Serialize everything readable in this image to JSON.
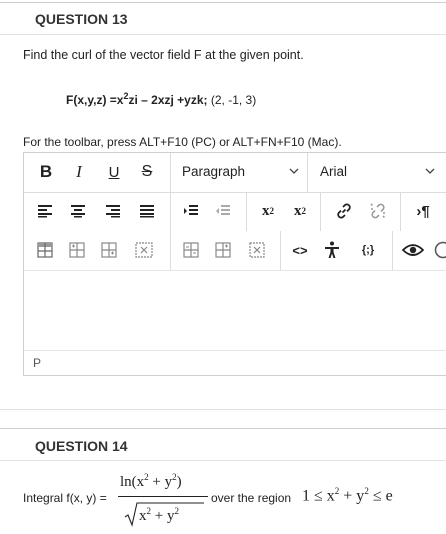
{
  "q13": {
    "title": "QUESTION 13",
    "prompt": "Find the curl of the vector field F at the given point.",
    "formula": {
      "lhs": "F(x,y,z) =x",
      "exp1": "2",
      "t1": "zi – 2xzj +yzk;",
      "point": "(2, -1, 3)"
    },
    "toolbar_hint": "For the toolbar, press ALT+F10 (PC) or ALT+FN+F10 (Mac)."
  },
  "editor": {
    "format_select": "Paragraph",
    "font_select": "Arial",
    "status_path": "P",
    "colors": {
      "border": "#cfcfcf",
      "icon": "#222222"
    }
  },
  "q14": {
    "title": "QUESTION 14",
    "label": "Integral f(x, y) =",
    "numerator": {
      "fn": "ln(x",
      "e1": "2",
      "plus": " + y",
      "e2": "2",
      "close": ")"
    },
    "denominator": {
      "x": "x",
      "e1": "2",
      "plus": " + y",
      "e2": "2"
    },
    "region_text": "over the region",
    "region": {
      "one": "1 ≤ x",
      "e1": "2",
      "plus": " + y",
      "e2": "2",
      "tail": " ≤ e"
    }
  }
}
